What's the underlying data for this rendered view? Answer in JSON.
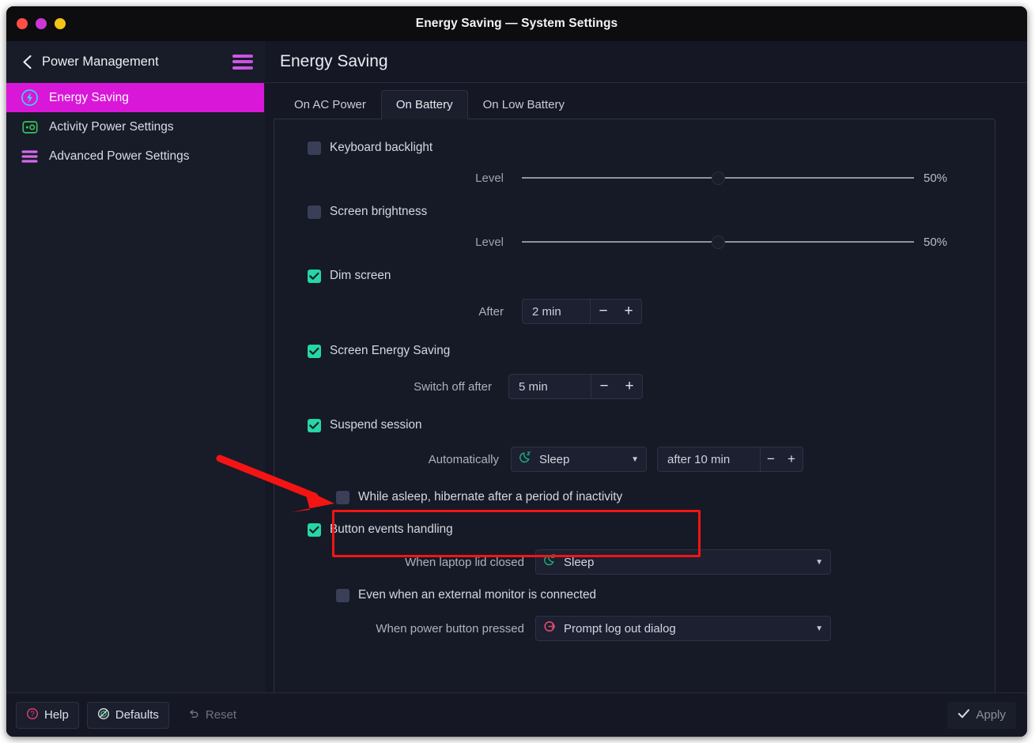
{
  "window": {
    "title": "Energy Saving — System Settings",
    "traffic_lights": [
      "close-red",
      "maximize-purple",
      "minimize-yellow"
    ]
  },
  "sidebar": {
    "back_label": "Power Management",
    "back_icon": "chevron-left-icon",
    "menu_icon": "hamburger-menu-icon",
    "items": [
      {
        "label": "Energy Saving",
        "icon": "energy-bolt-icon",
        "active": true
      },
      {
        "label": "Activity Power Settings",
        "icon": "activity-monitor-icon",
        "active": false
      },
      {
        "label": "Advanced Power Settings",
        "icon": "sliders-lines-icon",
        "active": false
      }
    ]
  },
  "header": {
    "title": "Energy Saving"
  },
  "tabs": [
    {
      "label": "On AC Power",
      "selected": false
    },
    {
      "label": "On Battery",
      "selected": true
    },
    {
      "label": "On Low Battery",
      "selected": false
    }
  ],
  "settings": {
    "keyboard_backlight": {
      "label": "Keyboard backlight",
      "checked": false,
      "level_label": "Level",
      "level_value": "50%",
      "level_pct": 50
    },
    "screen_brightness": {
      "label": "Screen brightness",
      "checked": false,
      "level_label": "Level",
      "level_value": "50%",
      "level_pct": 50
    },
    "dim_screen": {
      "label": "Dim screen",
      "checked": true,
      "after_label": "After",
      "after_value": "2 min",
      "minus": "−",
      "plus": "+"
    },
    "screen_energy_saving": {
      "label": "Screen Energy Saving",
      "checked": true,
      "switch_off_label": "Switch off after",
      "switch_off_value": "5 min",
      "minus": "−",
      "plus": "+"
    },
    "suspend_session": {
      "label": "Suspend session",
      "checked": true,
      "automatically_label": "Automatically",
      "action_value": "Sleep",
      "action_icon": "moon-sleep-icon",
      "delay_value": "after 10 min",
      "minus": "−",
      "plus": "+",
      "hibernate_label": "While asleep, hibernate after a period of inactivity",
      "hibernate_checked": false
    },
    "button_events": {
      "label": "Button events handling",
      "checked": true,
      "lid_label": "When laptop lid closed",
      "lid_value": "Sleep",
      "lid_icon": "moon-sleep-icon",
      "external_monitor_label": "Even when an external monitor is connected",
      "external_monitor_checked": false,
      "power_button_label": "When power button pressed",
      "power_button_value": "Prompt log out dialog",
      "power_button_icon": "logout-power-icon"
    }
  },
  "footer": {
    "help": {
      "label": "Help",
      "icon": "help-question-icon"
    },
    "defaults": {
      "label": "Defaults",
      "icon": "defaults-spiral-icon"
    },
    "reset": {
      "label": "Reset",
      "icon": "undo-arrow-icon",
      "enabled": false
    },
    "apply": {
      "label": "Apply",
      "icon": "checkmark-icon",
      "enabled": false
    }
  },
  "annotations": {
    "highlight_color": "#f41414",
    "arrow_color": "#f41414"
  }
}
